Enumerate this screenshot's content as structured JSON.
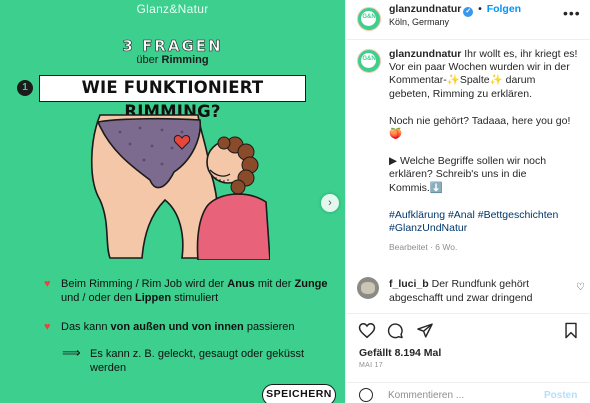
{
  "image": {
    "brand": "Glanz&Natur",
    "kicker": "3 FRAGEN",
    "kicker_sub_prefix": "über",
    "kicker_sub_bold": "Rimming",
    "question_number": "1",
    "question": "WIE FUNKTIONIERT RIMMING?",
    "bullets": [
      {
        "icon": "heart-icon",
        "parts": [
          {
            "t": "Beim Rimming / Rim Job wird der ",
            "b": false
          },
          {
            "t": "Anus",
            "b": true
          },
          {
            "t": " mit der ",
            "b": false
          },
          {
            "t": "Zunge",
            "b": true
          },
          {
            "t": " und / oder den ",
            "b": false
          },
          {
            "t": "Lippen",
            "b": true
          },
          {
            "t": " stimuliert",
            "b": false
          }
        ]
      },
      {
        "icon": "heart-icon",
        "parts": [
          {
            "t": "Das kann ",
            "b": false
          },
          {
            "t": "von außen und von innen",
            "b": true
          },
          {
            "t": " passieren",
            "b": false
          }
        ]
      },
      {
        "icon": "arrow-right-icon",
        "parts": [
          {
            "t": "Es kann z. B. geleckt, gesaugt oder geküsst werden",
            "b": false
          }
        ]
      }
    ],
    "save_pill": "SPEICHERN",
    "colors": {
      "background": "#3ccf8e",
      "ink": "#1b1b1b",
      "heart": "#e8453c"
    }
  },
  "header": {
    "username": "glanzundnatur",
    "verified": true,
    "separator": "•",
    "follow_label": "Folgen",
    "location": "Köln, Germany"
  },
  "caption": {
    "username": "glanzundnatur",
    "paragraphs": [
      "Ihr wollt es, ihr kriegt es! Vor ein paar Wochen wurden wir in der Kommentar-✨Spalte✨ darum gebeten, Rimming zu erklären.",
      "Noch nie gehört? Tadaaa, here you go! 🍑",
      "▶ Welche Begriffe sollen wir noch erklären? Schreib's uns in die Kommis.⬇️"
    ],
    "spacer": "⠀",
    "hashtags": [
      "#Aufklärung",
      "#Anal",
      "#Bettgeschichten",
      "#GlanzUndNatur"
    ],
    "meta": "Bearbeitet · 6 Wo."
  },
  "comments": [
    {
      "username": "f_luci_b",
      "text": "Der Rundfunk gehört abgeschafft und zwar dringend"
    }
  ],
  "actions": {
    "likes": "Gefällt 8.194 Mal",
    "date": "MAI 17"
  },
  "comment_box": {
    "placeholder": "Kommentieren ...",
    "post_label": "Posten"
  }
}
